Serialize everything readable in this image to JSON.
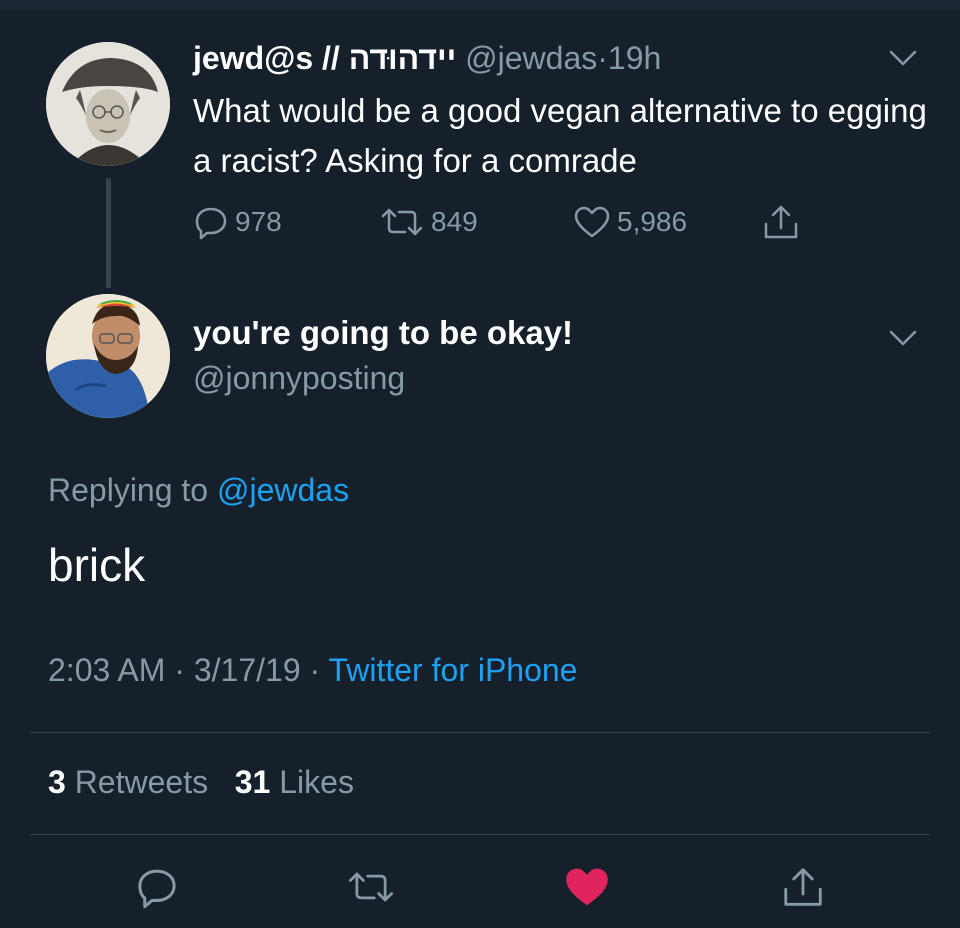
{
  "colors": {
    "background": "#15202b",
    "text": "#ffffff",
    "secondary": "#8899a6",
    "link": "#1da1f2",
    "like": "#e0245e",
    "divider": "#38444d"
  },
  "original_tweet": {
    "display_name": "jewd@s // יידהוּדה",
    "handle": "@jewdas",
    "separator": "·",
    "time": "19h",
    "text": "What would be a good vegan alternative to egging a racist? Asking for a comrade",
    "reply_count": "978",
    "retweet_count": "849",
    "like_count": "5,986",
    "icons": [
      "reply-icon",
      "retweet-icon",
      "like-icon",
      "share-icon",
      "chevron-down-icon"
    ]
  },
  "reply_tweet": {
    "display_name": "you're going to be okay!",
    "handle": "@jonnyposting",
    "replying_prefix": "Replying to",
    "replying_to": "@jewdas",
    "text": "brick",
    "time": "2:03 AM",
    "date": "3/17/19",
    "separator": "·",
    "source": "Twitter for iPhone",
    "retweets_count": "3",
    "retweets_label": "Retweets",
    "likes_count": "31",
    "likes_label": "Likes"
  },
  "bottom_actions": [
    "reply-icon",
    "retweet-icon",
    "like-icon",
    "share-icon"
  ]
}
